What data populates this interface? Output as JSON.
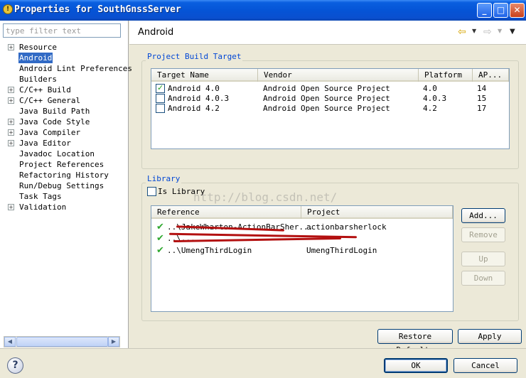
{
  "window": {
    "title": "Properties for SouthGnssServer",
    "icon_glyph": "!",
    "minimize_glyph": "_",
    "maximize_glyph": "□",
    "close_glyph": "✕"
  },
  "filter": {
    "placeholder": "type filter text"
  },
  "tree": [
    {
      "label": "Resource",
      "expandable": true
    },
    {
      "label": "Android",
      "expandable": false,
      "selected": true
    },
    {
      "label": "Android Lint Preferences",
      "expandable": false
    },
    {
      "label": "Builders",
      "expandable": false
    },
    {
      "label": "C/C++ Build",
      "expandable": true
    },
    {
      "label": "C/C++ General",
      "expandable": true
    },
    {
      "label": "Java Build Path",
      "expandable": false
    },
    {
      "label": "Java Code Style",
      "expandable": true
    },
    {
      "label": "Java Compiler",
      "expandable": true
    },
    {
      "label": "Java Editor",
      "expandable": true
    },
    {
      "label": "Javadoc Location",
      "expandable": false
    },
    {
      "label": "Project References",
      "expandable": false
    },
    {
      "label": "Refactoring History",
      "expandable": false
    },
    {
      "label": "Run/Debug Settings",
      "expandable": false
    },
    {
      "label": "Task Tags",
      "expandable": false
    },
    {
      "label": "Validation",
      "expandable": true
    }
  ],
  "page": {
    "title": "Android"
  },
  "toolbar_icons": {
    "back": "⇦",
    "forward": "⇨",
    "dropdown": "▼",
    "view_menu": "▼"
  },
  "build_target": {
    "group_label": "Project Build Target",
    "columns": [
      "Target Name",
      "Vendor",
      "Platform",
      "AP..."
    ],
    "rows": [
      {
        "name": "Android 4.0",
        "vendor": "Android Open Source Project",
        "platform": "4.0",
        "api": "14",
        "checked": true
      },
      {
        "name": "Android 4.0.3",
        "vendor": "Android Open Source Project",
        "platform": "4.0.3",
        "api": "15",
        "checked": false
      },
      {
        "name": "Android 4.2",
        "vendor": "Android Open Source Project",
        "platform": "4.2",
        "api": "17",
        "checked": false
      }
    ]
  },
  "library": {
    "group_label": "Library",
    "is_library_label": "Is Library",
    "is_library_checked": false,
    "columns": [
      "Reference",
      "Project"
    ],
    "rows": [
      {
        "reference": "..\\JakeWharton-ActionBarSher...",
        "project": "actionbarsherlock"
      },
      {
        "reference": "..\\...",
        "project": ""
      },
      {
        "reference": "..\\UmengThirdLogin",
        "project": "UmengThirdLogin"
      }
    ],
    "buttons": {
      "add": "Add...",
      "remove": "Remove",
      "up": "Up",
      "down": "Down"
    }
  },
  "watermark": "http://blog.csdn.net/",
  "footer_buttons": {
    "restore": "Restore Defaults",
    "apply": "Apply",
    "ok": "OK",
    "cancel": "Cancel"
  },
  "help_glyph": "?"
}
